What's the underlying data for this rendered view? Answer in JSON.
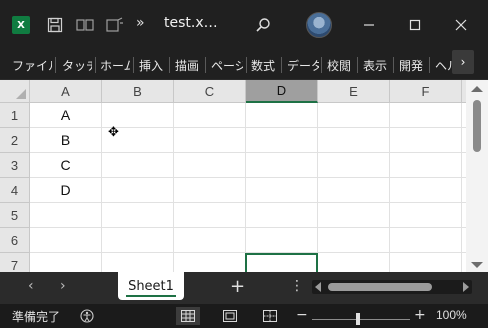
{
  "titlebar": {
    "app_icon": "excel-icon",
    "app_icon_letter": "X",
    "save_icon": "save-icon",
    "quick_access_icons": [
      "share-icon",
      "touch-mode-icon"
    ],
    "overflow_label": "»",
    "title": "test.x…",
    "search_icon": "search-icon",
    "avatar_icon": "user-avatar",
    "window_controls": [
      "minimize-icon",
      "maximize-icon",
      "close-icon"
    ]
  },
  "ribbon": {
    "tabs": [
      "ファイル",
      "タッチ",
      "ホーム",
      "挿入",
      "描画",
      "ページ",
      "数式",
      "データ",
      "校閲",
      "表示",
      "開発",
      "ヘルプ"
    ],
    "more_label": "›"
  },
  "sheet": {
    "columns": [
      "A",
      "B",
      "C",
      "D",
      "E",
      "F"
    ],
    "selected_column": "D",
    "rows": [
      "1",
      "2",
      "3",
      "4",
      "5",
      "6",
      "7"
    ],
    "cells": [
      [
        "A",
        "",
        "",
        "",
        "",
        ""
      ],
      [
        "B",
        "",
        "",
        "",
        "",
        ""
      ],
      [
        "C",
        "",
        "",
        "",
        "",
        ""
      ],
      [
        "D",
        "",
        "",
        "",
        "",
        ""
      ],
      [
        "",
        "",
        "",
        "",
        "",
        ""
      ],
      [
        "",
        "",
        "",
        "",
        "",
        ""
      ],
      [
        "",
        "",
        "",
        "",
        "",
        ""
      ]
    ],
    "active_cell": "D7"
  },
  "sheet_tabs": {
    "nav_prev": "‹",
    "nav_next": "›",
    "tabs": [
      "Sheet1"
    ],
    "add_label": "+",
    "menu_label": "⋮"
  },
  "status": {
    "text": "準備完了",
    "accessibility_icon": "accessibility-icon",
    "views": [
      "normal-view-icon",
      "page-layout-icon",
      "page-break-preview-icon"
    ],
    "zoom_minus": "−",
    "zoom_plus": "+",
    "zoom": "100%"
  },
  "colors": {
    "accent": "#1e7145",
    "excel_green": "#107c41"
  }
}
